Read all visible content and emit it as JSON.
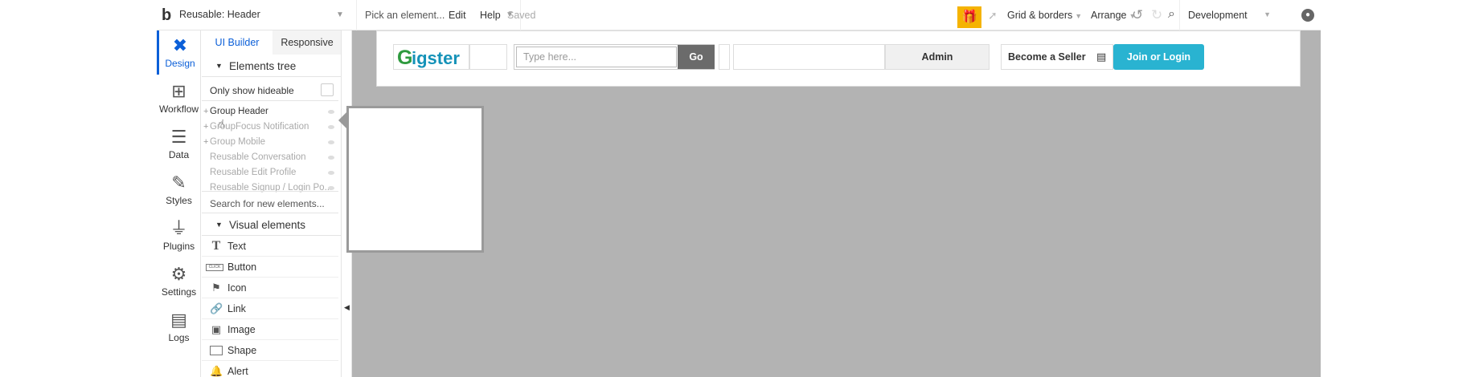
{
  "topbar": {
    "page_name": "Reusable: Header",
    "element_picker": "Pick an element...",
    "menu_edit": "Edit",
    "menu_help": "Help",
    "status": "Saved",
    "grid_borders": "Grid & borders",
    "arrange": "Arrange",
    "environment": "Development"
  },
  "leftnav": {
    "items": [
      {
        "label": "Design",
        "icon": "design-icon"
      },
      {
        "label": "Workflow",
        "icon": "workflow-icon"
      },
      {
        "label": "Data",
        "icon": "database-icon"
      },
      {
        "label": "Styles",
        "icon": "brush-icon"
      },
      {
        "label": "Plugins",
        "icon": "plug-icon"
      },
      {
        "label": "Settings",
        "icon": "gear-icon"
      },
      {
        "label": "Logs",
        "icon": "document-icon"
      }
    ]
  },
  "panel": {
    "tabs": [
      "UI Builder",
      "Responsive"
    ],
    "elements_tree_title": "Elements tree",
    "only_show_hideable": "Only show hideable",
    "tree": [
      "Group Header",
      "GroupFocus Notification",
      "Group Mobile",
      "Reusable Conversation",
      "Reusable Edit Profile",
      "Reusable Signup / Login Po..."
    ],
    "search_placeholder": "Search for new elements...",
    "visual_elements_title": "Visual elements",
    "visual_elements": [
      "Text",
      "Button",
      "Icon",
      "Link",
      "Image",
      "Shape",
      "Alert"
    ],
    "button_icon_text": "CLICK"
  },
  "canvas": {
    "logo_first": "G",
    "logo_rest": "igster",
    "search_placeholder": "Type here...",
    "go_label": "Go",
    "admin_label": "Admin",
    "seller_label": "Become a Seller",
    "join_label": "Join or Login"
  },
  "colors": {
    "accent": "#0b5fd8",
    "canvas_bg": "#b3b3b3",
    "join_button": "#29b3d1",
    "gift": "#f5b301",
    "go_button": "#6b6b6b"
  }
}
